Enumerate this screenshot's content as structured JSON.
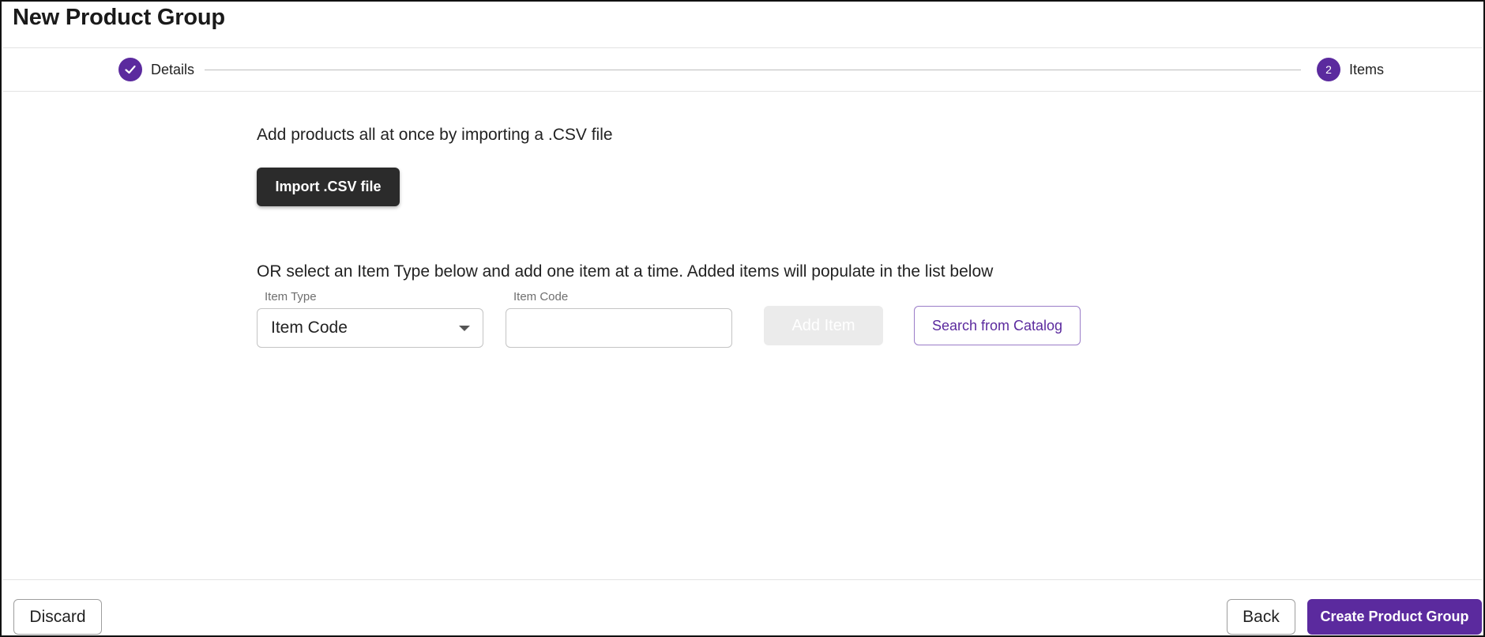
{
  "header": {
    "title": "New Product Group"
  },
  "stepper": {
    "steps": [
      {
        "label": "Details",
        "status": "completed",
        "icon": "check-icon"
      },
      {
        "label": "Items",
        "number": "2",
        "status": "active"
      }
    ],
    "accent_color": "#5b2a9e"
  },
  "import_section": {
    "description": "Add products all at once by importing a .CSV file",
    "import_button_label": "Import .CSV file"
  },
  "add_section": {
    "description": "OR select an Item Type below and add one item at a time. Added items will populate in the list below",
    "item_type": {
      "label": "Item Type",
      "value": "Item Code"
    },
    "item_code": {
      "label": "Item Code",
      "value": "",
      "placeholder": ""
    },
    "add_item_label": "Add Item",
    "search_catalog_label": "Search from Catalog"
  },
  "footer": {
    "discard_label": "Discard",
    "back_label": "Back",
    "create_label": "Create Product Group"
  },
  "colors": {
    "primary": "#5b2a9e",
    "dark_button": "#2b2b2b",
    "disabled": "#ebebeb"
  }
}
